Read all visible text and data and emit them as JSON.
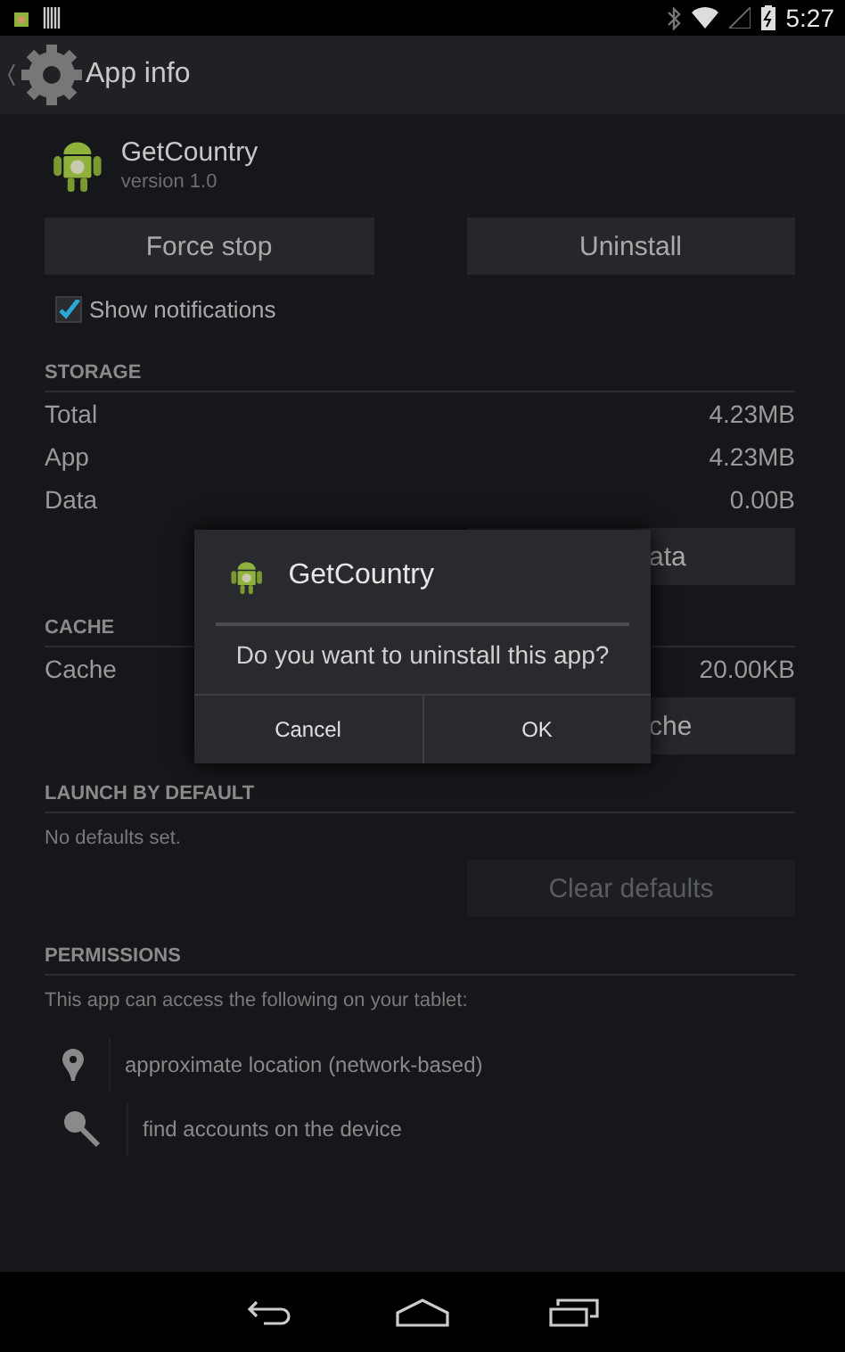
{
  "status_bar": {
    "time": "5:27"
  },
  "action_bar": {
    "title": "App info"
  },
  "app": {
    "name": "GetCountry",
    "version": "version 1.0"
  },
  "actions": [
    {
      "label": "Force stop",
      "disabled": false
    },
    {
      "label": "Uninstall",
      "disabled": false
    }
  ],
  "show_notifications": {
    "label": "Show notifications",
    "checked": true
  },
  "storage": {
    "header": "STORAGE",
    "rows": [
      {
        "label": "Total",
        "value": "4.23MB"
      },
      {
        "label": "App",
        "value": "4.23MB"
      },
      {
        "label": "Data",
        "value": "0.00B"
      }
    ],
    "button": {
      "label": "ata"
    }
  },
  "cache": {
    "header": "CACHE",
    "rows": [
      {
        "label": "Cache",
        "value": "20.00KB"
      }
    ],
    "button": {
      "label": "che"
    }
  },
  "launch": {
    "header": "LAUNCH BY DEFAULT",
    "text": "No defaults set.",
    "button": {
      "label": "Clear defaults",
      "disabled": true
    }
  },
  "permissions": {
    "header": "PERMISSIONS",
    "intro": "This app can access the following on your tablet:",
    "items": [
      {
        "kind": "location",
        "label": "approximate location (network-based)"
      },
      {
        "kind": "key",
        "label": "find accounts on the device"
      }
    ]
  },
  "dialog": {
    "title": "GetCountry",
    "message": "Do you want to uninstall this app?",
    "buttons": [
      "Cancel",
      "OK"
    ]
  }
}
